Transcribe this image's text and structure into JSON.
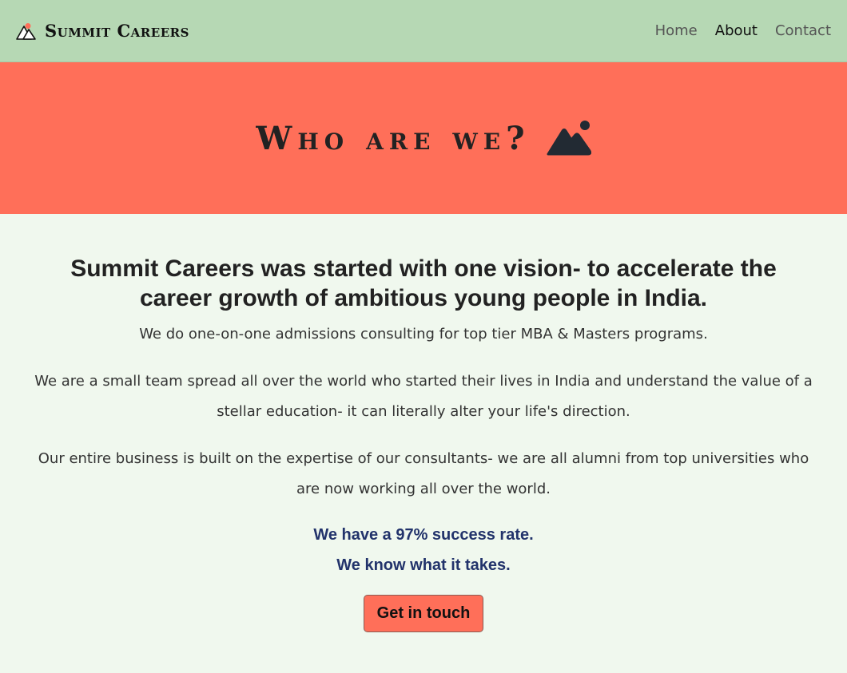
{
  "nav": {
    "brand_name": "Summit Careers",
    "logo_icon": "mountain-logo-icon",
    "links": [
      "Home",
      "About",
      "Contact"
    ],
    "active_link": "About"
  },
  "hero": {
    "title": "Who are we?",
    "icon": "mountain-icon"
  },
  "main": {
    "headline": "Summit Careers was started with one vision- to accelerate the career growth of ambitious young people in India.",
    "paragraphs": [
      "We do one-on-one admissions consulting for top tier MBA & Masters programs.",
      "We are a small team spread all over the world who started their lives in India and understand the value of a stellar education- it can literally alter your life's direction.",
      "Our entire business is built on the expertise of our consultants- we are all alumni from top universities who are now working all over the world."
    ],
    "highlights": [
      "We have a 97% success rate.",
      "We know what it takes."
    ],
    "cta_label": "Get in touch"
  },
  "colors": {
    "navbar_bg": "#b6d8b4",
    "hero_bg": "#ff6f59",
    "page_bg": "#f0f8ee",
    "highlight_text": "#22336b"
  }
}
